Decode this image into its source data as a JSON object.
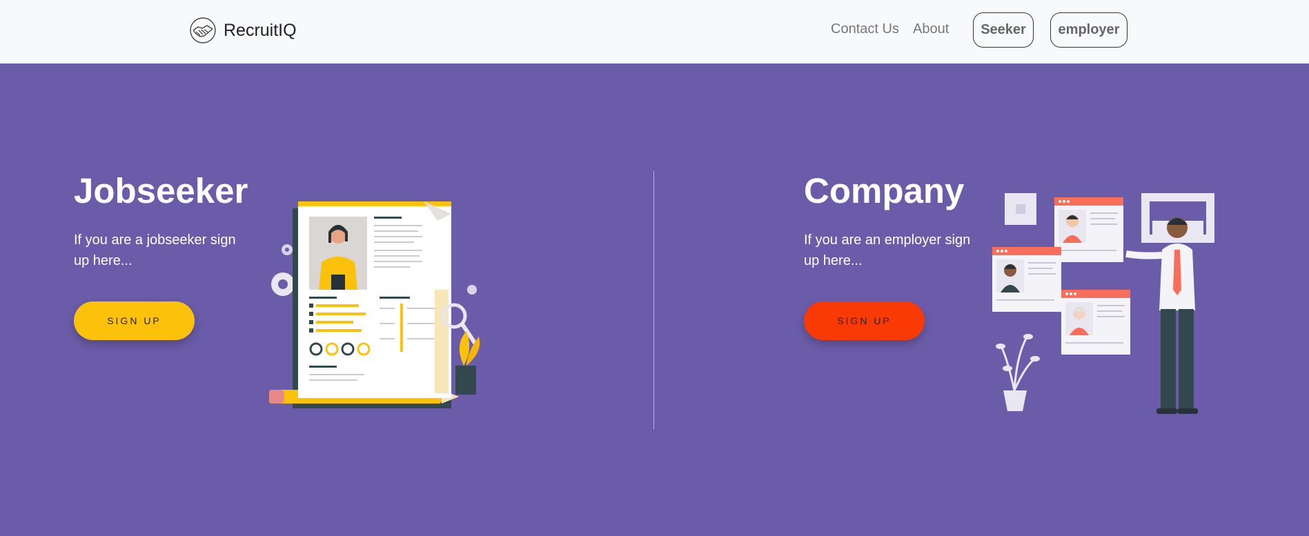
{
  "navbar": {
    "brand": {
      "name": "RecruitIQ",
      "icon": "handshake-icon"
    },
    "links": {
      "contact": "Contact Us",
      "about": "About"
    },
    "buttons": {
      "seeker": "Seeker",
      "employer": "employer"
    }
  },
  "jobseeker": {
    "title": "Jobseeker",
    "description": "If you are a jobseeker sign up here...",
    "button_label": "SIGN UP",
    "illustration": "resume-illustration"
  },
  "company": {
    "title": "Company",
    "description": "If you are an employer sign up here...",
    "button_label": "SIGN UP",
    "illustration": "hiring-illustration"
  },
  "colors": {
    "background": "#6a5ca8",
    "navbar": "#f8f9fa",
    "seeker_button": "#fbc10b",
    "company_button": "#fa3a04"
  }
}
